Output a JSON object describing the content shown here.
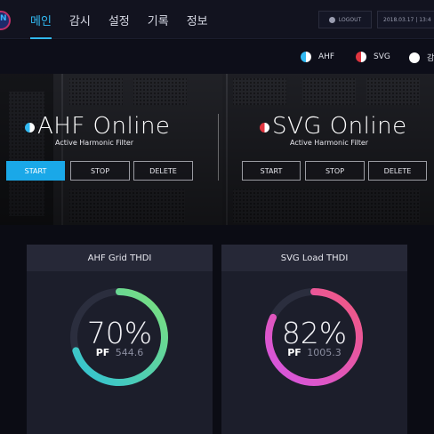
{
  "logo_text": "N",
  "nav": {
    "items": [
      {
        "label": "메인",
        "active": true
      },
      {
        "label": "감시",
        "active": false
      },
      {
        "label": "설정",
        "active": false
      },
      {
        "label": "기록",
        "active": false
      },
      {
        "label": "정보",
        "active": false
      }
    ],
    "logout_label": "LOGOUT",
    "datetime": "2018.03.17 | 13:4"
  },
  "legend": [
    {
      "label": "AHF",
      "icon": "half-circle-blue-icon",
      "color": "#31b9f2"
    },
    {
      "label": "SVG",
      "icon": "half-circle-red-icon",
      "color": "#e0353f"
    },
    {
      "label": "감",
      "icon": "white-circle-icon",
      "color": "#ffffff"
    }
  ],
  "panels": [
    {
      "title": "AHF Online",
      "subtitle": "Active Harmonic Filter",
      "status_color": "#31b9f2",
      "buttons": {
        "start": "START",
        "stop": "STOP",
        "delete": "DELETE"
      }
    },
    {
      "title": "SVG Online",
      "subtitle": "Active Harmonic Filter",
      "status_color": "#e0353f",
      "buttons": {
        "start": "START",
        "stop": "STOP",
        "delete": "DELETE"
      }
    }
  ],
  "cards": [
    {
      "title": "AHF Grid THDI",
      "percent_text": "70%",
      "percent": 70,
      "pf_label": "PF",
      "pf_value": "544.6",
      "gradient": [
        "#2fc1d8",
        "#7ee07a"
      ]
    },
    {
      "title": "SVG Load THDI",
      "percent_text": "82%",
      "percent": 82,
      "pf_label": "PF",
      "pf_value": "1005.3",
      "gradient": [
        "#d455e6",
        "#f2587e"
      ]
    }
  ]
}
